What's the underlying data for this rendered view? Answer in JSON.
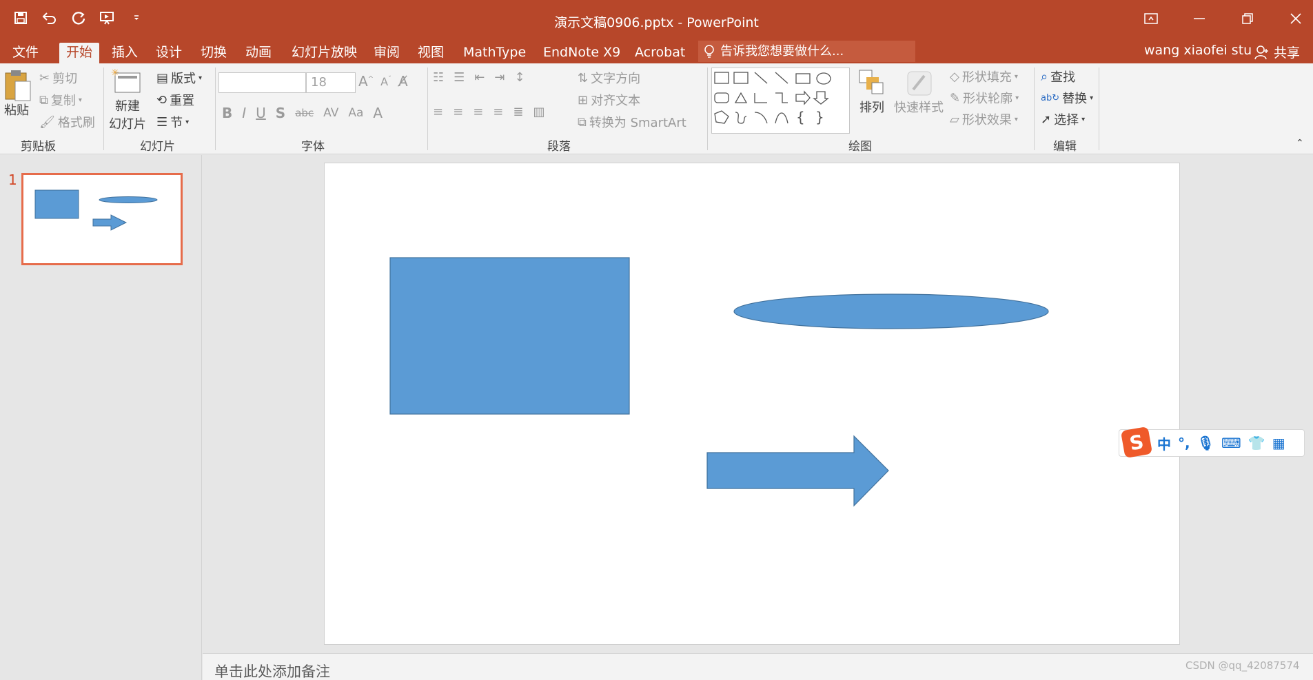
{
  "app": {
    "title": "演示文稿0906.pptx - PowerPoint",
    "accent": "#b7472a"
  },
  "qat": {
    "save_icon": "save-icon",
    "undo_icon": "undo-icon",
    "redo_icon": "redo-icon",
    "present_icon": "present-icon",
    "customize_icon": "chevron-down-icon"
  },
  "tabs": [
    {
      "label": "文件"
    },
    {
      "label": "开始"
    },
    {
      "label": "插入"
    },
    {
      "label": "设计"
    },
    {
      "label": "切换"
    },
    {
      "label": "动画"
    },
    {
      "label": "幻灯片放映"
    },
    {
      "label": "审阅"
    },
    {
      "label": "视图"
    },
    {
      "label": "MathType"
    },
    {
      "label": "EndNote X9"
    },
    {
      "label": "Acrobat"
    }
  ],
  "tellme": "告诉我您想要做什么...",
  "user": "wang xiaofei stu",
  "share": "共享",
  "ribbon": {
    "clipboard": {
      "paste": "粘贴",
      "cut": "剪切",
      "copy": "复制",
      "format_painter": "格式刷",
      "label": "剪贴板"
    },
    "slides": {
      "new_slide_1": "新建",
      "new_slide_2": "幻灯片",
      "layout": "版式",
      "reset": "重置",
      "section": "节",
      "label": "幻灯片"
    },
    "font": {
      "font_name": "",
      "font_size": "18",
      "label": "字体"
    },
    "paragraph": {
      "text_direction": "文字方向",
      "align_text": "对齐文本",
      "smartart": "转换为 SmartArt",
      "label": "段落"
    },
    "drawing": {
      "arrange": "排列",
      "quick_styles": "快速样式",
      "shape_fill": "形状填充",
      "shape_outline": "形状轮廓",
      "shape_effects": "形状效果",
      "label": "绘图"
    },
    "editing": {
      "find": "查找",
      "replace": "替换",
      "select": "选择",
      "label": "编辑"
    }
  },
  "thumbnail": {
    "number": "1"
  },
  "slide": {
    "shape_color": "#5b9bd5",
    "shape_border": "#41719c"
  },
  "notes": "单击此处添加备注",
  "ime": {
    "label": "中",
    "punct": "°,"
  },
  "watermark": "CSDN @qq_42087574"
}
